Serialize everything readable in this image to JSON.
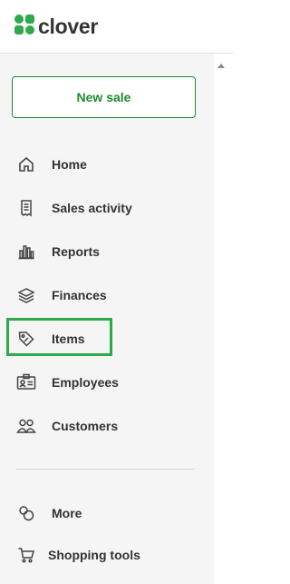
{
  "header": {
    "logo_text": "clover",
    "logo_icon": "clover-leaf-icon",
    "brand_color": "#1d8a2f"
  },
  "new_sale_label": "New sale",
  "nav": [
    {
      "label": "Home",
      "icon": "home-icon"
    },
    {
      "label": "Sales activity",
      "icon": "receipt-icon"
    },
    {
      "label": "Reports",
      "icon": "bar-chart-icon"
    },
    {
      "label": "Finances",
      "icon": "stacked-layers-icon"
    },
    {
      "label": "Items",
      "icon": "tag-icon",
      "highlighted": true
    },
    {
      "label": "Employees",
      "icon": "id-card-icon"
    },
    {
      "label": "Customers",
      "icon": "people-icon"
    }
  ],
  "nav_secondary": [
    {
      "label": "More",
      "icon": "circles-icon"
    },
    {
      "label": "Shopping tools",
      "icon": "shopping-cart-icon"
    }
  ],
  "colors": {
    "highlight": "#2ea94a",
    "sidebar_bg": "#f5f5f5"
  }
}
